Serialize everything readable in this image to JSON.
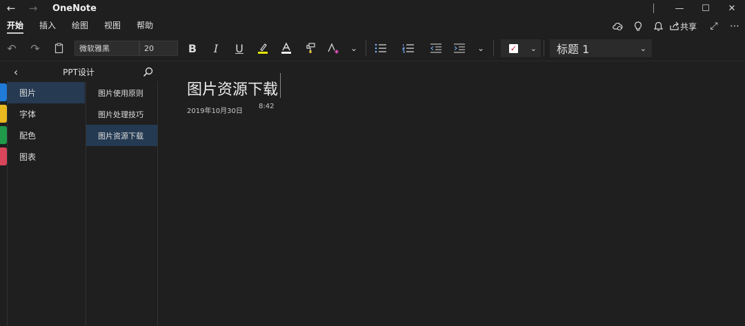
{
  "app": {
    "title": "OneNote"
  },
  "ribbon": {
    "tabs": [
      "开始",
      "插入",
      "绘图",
      "视图",
      "帮助"
    ],
    "share_label": "共享"
  },
  "toolbar": {
    "font_name": "微软雅黑",
    "font_size": "20",
    "style": "标题 1"
  },
  "notebook": {
    "name": "PPT设计"
  },
  "sections": [
    {
      "label": "图片",
      "color": "#1f7ad8"
    },
    {
      "label": "字体",
      "color": "#e8b820"
    },
    {
      "label": "配色",
      "color": "#1f9a4a"
    },
    {
      "label": "图表",
      "color": "#d9455a"
    }
  ],
  "pages": [
    "图片使用原则",
    "图片处理技巧",
    "图片资源下载"
  ],
  "page": {
    "title": "图片资源下载",
    "date": "2019年10月30日",
    "time": "8:42"
  },
  "colors": {
    "accent_selected": "#263a52",
    "background": "#1f1f1f"
  }
}
